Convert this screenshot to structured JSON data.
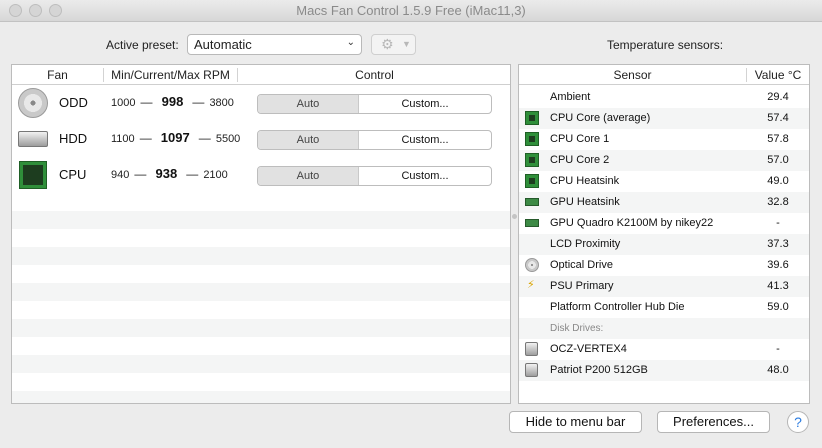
{
  "window": {
    "title": "Macs Fan Control 1.5.9 Free (iMac11,3)"
  },
  "preset": {
    "label": "Active preset:",
    "value": "Automatic"
  },
  "fans": {
    "headers": {
      "fan": "Fan",
      "rpm": "Min/Current/Max RPM",
      "control": "Control"
    },
    "rows": [
      {
        "name": "ODD",
        "icon": "optical-drive-icon",
        "min": "1000",
        "current": "998",
        "max": "3800",
        "auto_label": "Auto",
        "custom_label": "Custom..."
      },
      {
        "name": "HDD",
        "icon": "hard-drive-icon",
        "min": "1100",
        "current": "1097",
        "max": "5500",
        "auto_label": "Auto",
        "custom_label": "Custom..."
      },
      {
        "name": "CPU",
        "icon": "cpu-chip-icon",
        "min": "940",
        "current": "938",
        "max": "2100",
        "auto_label": "Auto",
        "custom_label": "Custom..."
      }
    ],
    "separator": "—"
  },
  "sensors": {
    "title": "Temperature sensors:",
    "headers": {
      "sensor": "Sensor",
      "value": "Value °C"
    },
    "rows": [
      {
        "name": "Ambient",
        "value": "29.4",
        "icon": ""
      },
      {
        "name": "CPU Core (average)",
        "value": "57.4",
        "icon": "cpu-chip-icon"
      },
      {
        "name": "CPU Core 1",
        "value": "57.8",
        "icon": "cpu-chip-icon"
      },
      {
        "name": "CPU Core 2",
        "value": "57.0",
        "icon": "cpu-chip-icon"
      },
      {
        "name": "CPU Heatsink",
        "value": "49.0",
        "icon": "cpu-chip-icon"
      },
      {
        "name": "GPU Heatsink",
        "value": "32.8",
        "icon": "gpu-card-icon"
      },
      {
        "name": "GPU Quadro K2100M by nikey22",
        "value": "-",
        "icon": "gpu-card-icon"
      },
      {
        "name": "LCD Proximity",
        "value": "37.3",
        "icon": ""
      },
      {
        "name": "Optical Drive",
        "value": "39.6",
        "icon": "optical-drive-icon"
      },
      {
        "name": "PSU Primary",
        "value": "41.3",
        "icon": "lightning-bolt-icon"
      },
      {
        "name": "Platform Controller Hub Die",
        "value": "59.0",
        "icon": ""
      }
    ],
    "disk_group_label": "Disk Drives:",
    "disks": [
      {
        "name": "OCZ-VERTEX4",
        "value": "-",
        "icon": "hard-drive-icon"
      },
      {
        "name": "Patriot P200 512GB",
        "value": "48.0",
        "icon": "hard-drive-icon"
      }
    ]
  },
  "footer": {
    "hide_label": "Hide to menu bar",
    "prefs_label": "Preferences...",
    "help_label": "?"
  }
}
